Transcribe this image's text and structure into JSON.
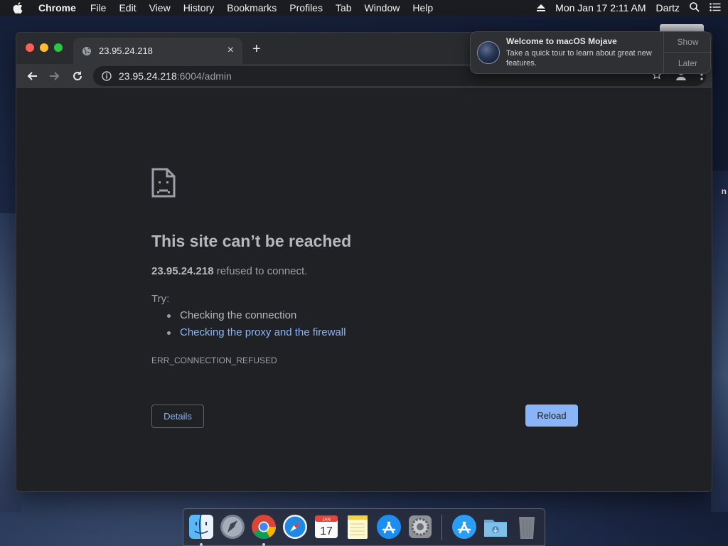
{
  "menubar": {
    "app_name": "Chrome",
    "items": [
      "File",
      "Edit",
      "View",
      "History",
      "Bookmarks",
      "Profiles",
      "Tab",
      "Window",
      "Help"
    ],
    "datetime": "Mon Jan 17  2:11 AM",
    "user": "Dartz"
  },
  "desktop": {
    "partial_label": "n"
  },
  "browser": {
    "tab_title": "23.95.24.218",
    "tab_close": "×",
    "new_tab": "+",
    "url_host": "23.95.24.218",
    "url_rest": ":6004/admin"
  },
  "error_page": {
    "title": "This site can’t be reached",
    "host": "23.95.24.218",
    "desc_suffix": " refused to connect.",
    "try_label": "Try:",
    "suggestion_1": "Checking the connection",
    "suggestion_2": "Checking the proxy and the firewall",
    "error_code": "ERR_CONNECTION_REFUSED",
    "details_label": "Details",
    "reload_label": "Reload"
  },
  "notification": {
    "title": "Welcome to macOS Mojave",
    "body": "Take a quick tour to learn about great new features.",
    "show_label": "Show",
    "later_label": "Later"
  },
  "dock": {
    "calendar_month": "JAN",
    "calendar_day": "17",
    "items": [
      "finder-icon",
      "launchpad-icon",
      "chrome-icon",
      "safari-icon",
      "calendar-icon",
      "notes-icon",
      "app-store-icon",
      "system-preferences-icon",
      "app-store-download-icon",
      "downloads-folder-icon",
      "trash-icon"
    ]
  },
  "colors": {
    "link": "#8ab4f8",
    "page_bg": "#202124",
    "reload_bg": "#8ab4f8"
  }
}
